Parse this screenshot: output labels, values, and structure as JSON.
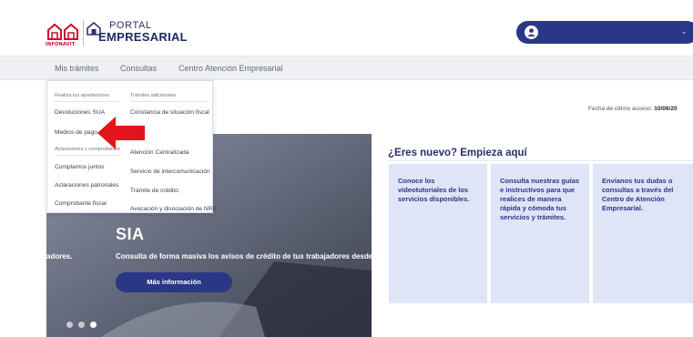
{
  "header": {
    "logo_sub": "INFONAVIT",
    "portal_top": "PORTAL",
    "portal_bottom": "EMPRESARIAL",
    "user_name": "",
    "accent_color": "#2a3786",
    "brand_red": "#c8102e"
  },
  "nav": {
    "items": [
      {
        "label": "Mis trámites"
      },
      {
        "label": "Consultas"
      },
      {
        "label": "Centro Atención Empresarial"
      }
    ]
  },
  "dropdown": {
    "col1_header": "Realiza tus aportaciones",
    "col1_items": [
      "Devoluciones SUA",
      "Medios de pago"
    ],
    "col1b_header": "Aclaraciones y comprobantes",
    "col1b_items": [
      "Cumplamos juntos",
      "Aclaraciones patronales",
      "Comprobante fiscal"
    ],
    "col2_header": "Trámites adicionales",
    "col2_items": [
      "Constancia de situación fiscal",
      "Atención Centralizada",
      "Servicio de intercomunicación",
      "Trámite de crédito",
      "Avocación y disociación de NRP"
    ]
  },
  "access": {
    "label": "Fecha de último acceso:",
    "date": "10/06/20"
  },
  "hero": {
    "title": "SIA",
    "left_fragment": "adores.",
    "description": "Consulta de forma masiva los avisos de crédito de tus trabajadores desde",
    "button_label": "Más información",
    "slides": 3,
    "active_slide": 3
  },
  "welcome": {
    "title": "¿Eres nuevo? Empieza aquí",
    "cards": [
      {
        "text": "Conoce los videotutoriales de los servicios disponibles."
      },
      {
        "text": "Consulta nuestras guías e instructivos para que realices de manera rápida y cómoda tus servicios y trámites."
      },
      {
        "text": "Envíanos tus dudas o consultas a través del Centro de Atención Empresarial."
      }
    ]
  }
}
